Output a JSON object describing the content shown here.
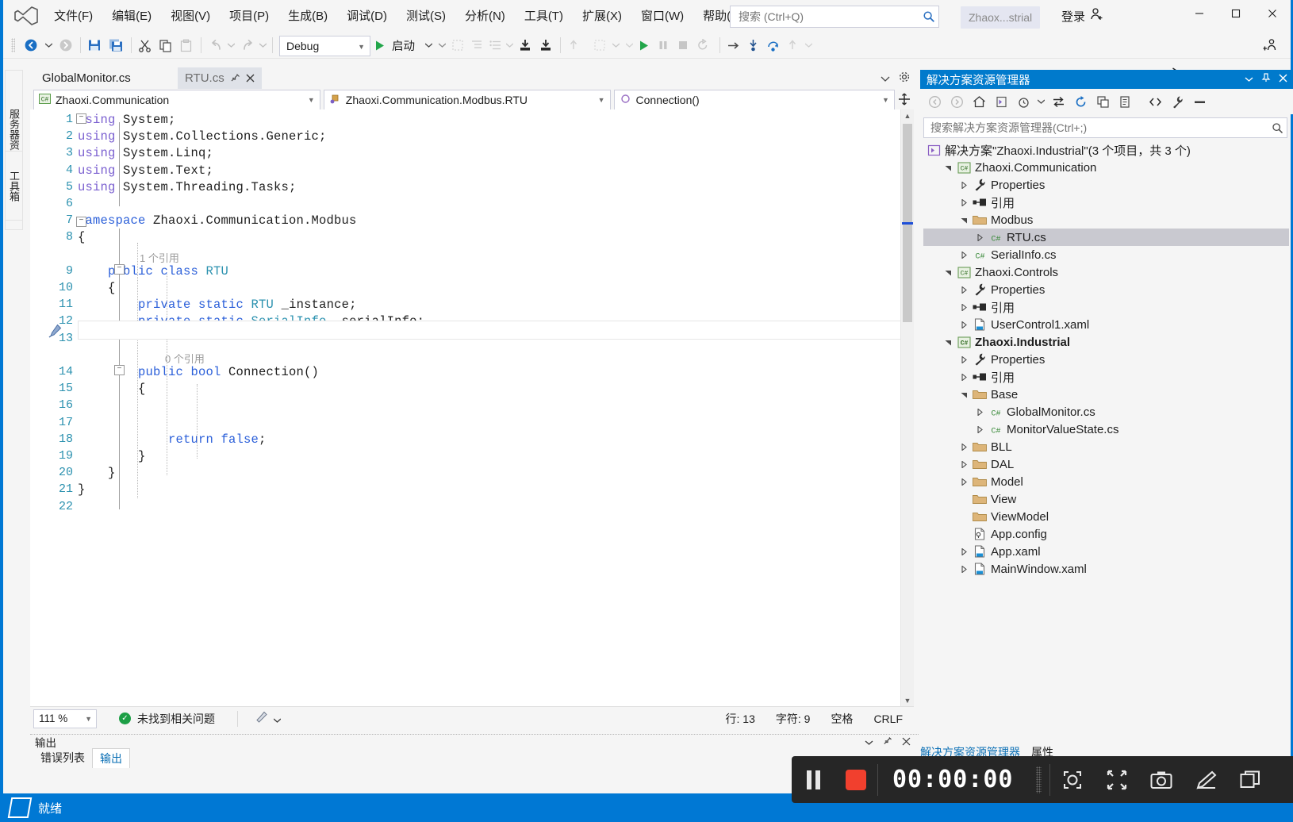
{
  "window": {
    "project_pill": "Zhaox...strial",
    "sign_in": "登录",
    "minimize": "—",
    "maximize": "▢",
    "close": "✕"
  },
  "menu": {
    "items": [
      {
        "label": "文件(F)",
        "name": "menu-file"
      },
      {
        "label": "编辑(E)",
        "name": "menu-edit"
      },
      {
        "label": "视图(V)",
        "name": "menu-view"
      },
      {
        "label": "项目(P)",
        "name": "menu-project"
      },
      {
        "label": "生成(B)",
        "name": "menu-build"
      },
      {
        "label": "调试(D)",
        "name": "menu-debug"
      },
      {
        "label": "测试(S)",
        "name": "menu-test"
      },
      {
        "label": "分析(N)",
        "name": "menu-analyze"
      },
      {
        "label": "工具(T)",
        "name": "menu-tools"
      },
      {
        "label": "扩展(X)",
        "name": "menu-extensions"
      },
      {
        "label": "窗口(W)",
        "name": "menu-window"
      },
      {
        "label": "帮助(H)",
        "name": "menu-help"
      }
    ]
  },
  "search": {
    "placeholder": "搜索 (Ctrl+Q)",
    "value": ""
  },
  "toolbar": {
    "config": "Debug",
    "start_label": "启动",
    "live_share": "Live Share"
  },
  "side_tabs": [
    {
      "label": "服务器资源管理器"
    },
    {
      "label": "工具箱"
    }
  ],
  "editor": {
    "tabs": [
      {
        "label": "GlobalMonitor.cs",
        "state": "inactive"
      },
      {
        "label": "RTU.cs",
        "state": "hover"
      }
    ],
    "nav": {
      "project": "Zhaoxi.Communication",
      "type": "Zhaoxi.Communication.Modbus.RTU",
      "member": "Connection()"
    },
    "codelens": [
      {
        "line": 9,
        "text": "1 个引用"
      },
      {
        "line": 14,
        "text": "0 个引用"
      }
    ],
    "lines": [
      {
        "n": 1,
        "tokens": [
          {
            "t": "using ",
            "c": "kw2"
          },
          {
            "t": "System;",
            "c": "id"
          }
        ]
      },
      {
        "n": 2,
        "tokens": [
          {
            "t": "using ",
            "c": "kw2"
          },
          {
            "t": "System.Collections.Generic;",
            "c": "id"
          }
        ]
      },
      {
        "n": 3,
        "tokens": [
          {
            "t": "using ",
            "c": "kw2"
          },
          {
            "t": "System.Linq;",
            "c": "id"
          }
        ]
      },
      {
        "n": 4,
        "tokens": [
          {
            "t": "using ",
            "c": "kw2"
          },
          {
            "t": "System.Text;",
            "c": "id"
          }
        ]
      },
      {
        "n": 5,
        "tokens": [
          {
            "t": "using ",
            "c": "kw2"
          },
          {
            "t": "System.Threading.Tasks;",
            "c": "id"
          }
        ]
      },
      {
        "n": 6,
        "tokens": []
      },
      {
        "n": 7,
        "tokens": [
          {
            "t": "namespace ",
            "c": "kw"
          },
          {
            "t": "Zhaoxi.Communication.Modbus",
            "c": "id"
          }
        ]
      },
      {
        "n": 8,
        "tokens": [
          {
            "t": "{",
            "c": "id"
          }
        ]
      },
      {
        "n": 9,
        "tokens": [
          {
            "t": "    public class ",
            "c": "kw"
          },
          {
            "t": "RTU",
            "c": "ty"
          }
        ]
      },
      {
        "n": 10,
        "tokens": [
          {
            "t": "    {",
            "c": "id"
          }
        ]
      },
      {
        "n": 11,
        "tokens": [
          {
            "t": "        private static ",
            "c": "kw"
          },
          {
            "t": "RTU",
            "c": "ty"
          },
          {
            "t": " _instance;",
            "c": "id"
          }
        ]
      },
      {
        "n": 12,
        "tokens": [
          {
            "t": "        private static ",
            "c": "kw"
          },
          {
            "t": "SerialInfo",
            "c": "ty"
          },
          {
            "t": " _serialInfo;",
            "c": "id"
          }
        ]
      },
      {
        "n": 13,
        "tokens": []
      },
      {
        "n": 14,
        "tokens": [
          {
            "t": "        public bool ",
            "c": "kw"
          },
          {
            "t": "Connection",
            "c": "id"
          },
          {
            "t": "()",
            "c": "id"
          }
        ]
      },
      {
        "n": 15,
        "tokens": [
          {
            "t": "        {",
            "c": "id"
          }
        ]
      },
      {
        "n": 16,
        "tokens": []
      },
      {
        "n": 17,
        "tokens": []
      },
      {
        "n": 18,
        "tokens": [
          {
            "t": "            return false",
            "c": "kw"
          },
          {
            "t": ";",
            "c": "id"
          }
        ]
      },
      {
        "n": 19,
        "tokens": [
          {
            "t": "        }",
            "c": "id"
          }
        ]
      },
      {
        "n": 20,
        "tokens": [
          {
            "t": "    }",
            "c": "id"
          }
        ]
      },
      {
        "n": 21,
        "tokens": [
          {
            "t": "}",
            "c": "id"
          }
        ]
      },
      {
        "n": 22,
        "tokens": []
      }
    ],
    "status": {
      "zoom": "111 %",
      "issues": "未找到相关问题",
      "line": "行: 13",
      "col": "字符: 9",
      "spaces": "空格",
      "eol": "CRLF"
    }
  },
  "output_panel": {
    "title": "输出",
    "tabs": [
      {
        "label": "错误列表",
        "active": false
      },
      {
        "label": "输出",
        "active": true
      }
    ]
  },
  "solution_explorer": {
    "title": "解决方案资源管理器",
    "search_placeholder": "搜索解决方案资源管理器(Ctrl+;)",
    "root": "解决方案\"Zhaoxi.Industrial\"(3 个项目，共 3 个)",
    "tree": [
      {
        "label": "Zhaoxi.Communication",
        "indent": 1,
        "icon": "csproj-icon",
        "arrow": "open",
        "bold": false,
        "selected": false
      },
      {
        "label": "Properties",
        "indent": 2,
        "icon": "wrench-icon",
        "arrow": "closed",
        "bold": false,
        "selected": false
      },
      {
        "label": "引用",
        "indent": 2,
        "icon": "references-icon",
        "arrow": "closed",
        "bold": false,
        "selected": false
      },
      {
        "label": "Modbus",
        "indent": 2,
        "icon": "folder-icon",
        "arrow": "open",
        "bold": false,
        "selected": false
      },
      {
        "label": "RTU.cs",
        "indent": 3,
        "icon": "cs-icon",
        "arrow": "closed",
        "bold": false,
        "selected": true
      },
      {
        "label": "SerialInfo.cs",
        "indent": 2,
        "icon": "cs-icon",
        "arrow": "closed",
        "bold": false,
        "selected": false
      },
      {
        "label": "Zhaoxi.Controls",
        "indent": 1,
        "icon": "csproj-icon",
        "arrow": "open",
        "bold": false,
        "selected": false
      },
      {
        "label": "Properties",
        "indent": 2,
        "icon": "wrench-icon",
        "arrow": "closed",
        "bold": false,
        "selected": false
      },
      {
        "label": "引用",
        "indent": 2,
        "icon": "references-icon",
        "arrow": "closed",
        "bold": false,
        "selected": false
      },
      {
        "label": "UserControl1.xaml",
        "indent": 2,
        "icon": "xaml-icon",
        "arrow": "closed",
        "bold": false,
        "selected": false
      },
      {
        "label": "Zhaoxi.Industrial",
        "indent": 1,
        "icon": "csproj-icon",
        "arrow": "open",
        "bold": true,
        "selected": false
      },
      {
        "label": "Properties",
        "indent": 2,
        "icon": "wrench-icon",
        "arrow": "closed",
        "bold": false,
        "selected": false
      },
      {
        "label": "引用",
        "indent": 2,
        "icon": "references-icon",
        "arrow": "closed",
        "bold": false,
        "selected": false
      },
      {
        "label": "Base",
        "indent": 2,
        "icon": "folder-icon",
        "arrow": "open",
        "bold": false,
        "selected": false
      },
      {
        "label": "GlobalMonitor.cs",
        "indent": 3,
        "icon": "cs-icon",
        "arrow": "closed",
        "bold": false,
        "selected": false
      },
      {
        "label": "MonitorValueState.cs",
        "indent": 3,
        "icon": "cs-icon",
        "arrow": "closed",
        "bold": false,
        "selected": false
      },
      {
        "label": "BLL",
        "indent": 2,
        "icon": "folder-icon",
        "arrow": "closed",
        "bold": false,
        "selected": false
      },
      {
        "label": "DAL",
        "indent": 2,
        "icon": "folder-icon",
        "arrow": "closed",
        "bold": false,
        "selected": false
      },
      {
        "label": "Model",
        "indent": 2,
        "icon": "folder-icon",
        "arrow": "closed",
        "bold": false,
        "selected": false
      },
      {
        "label": "View",
        "indent": 2,
        "icon": "folder-icon",
        "arrow": "none",
        "bold": false,
        "selected": false
      },
      {
        "label": "ViewModel",
        "indent": 2,
        "icon": "folder-icon",
        "arrow": "none",
        "bold": false,
        "selected": false
      },
      {
        "label": "App.config",
        "indent": 2,
        "icon": "config-icon",
        "arrow": "none",
        "bold": false,
        "selected": false
      },
      {
        "label": "App.xaml",
        "indent": 2,
        "icon": "xaml-icon",
        "arrow": "closed",
        "bold": false,
        "selected": false
      },
      {
        "label": "MainWindow.xaml",
        "indent": 2,
        "icon": "xaml-icon",
        "arrow": "closed",
        "bold": false,
        "selected": false
      }
    ],
    "bottom_tabs": [
      {
        "label": "解决方案资源管理器"
      },
      {
        "label": "属性"
      }
    ]
  },
  "taskbar": {
    "status": "就绪"
  },
  "recorder": {
    "time": "00:00:00"
  },
  "colors": {
    "accent": "#0078d4",
    "title_bar": "#007acc",
    "record_red": "#f1402e",
    "keyword": "#2b5fd9",
    "type": "#2b91af",
    "using": "#7a5fd0",
    "linenum": "#2b91af",
    "selection": "#c9c9d0"
  }
}
